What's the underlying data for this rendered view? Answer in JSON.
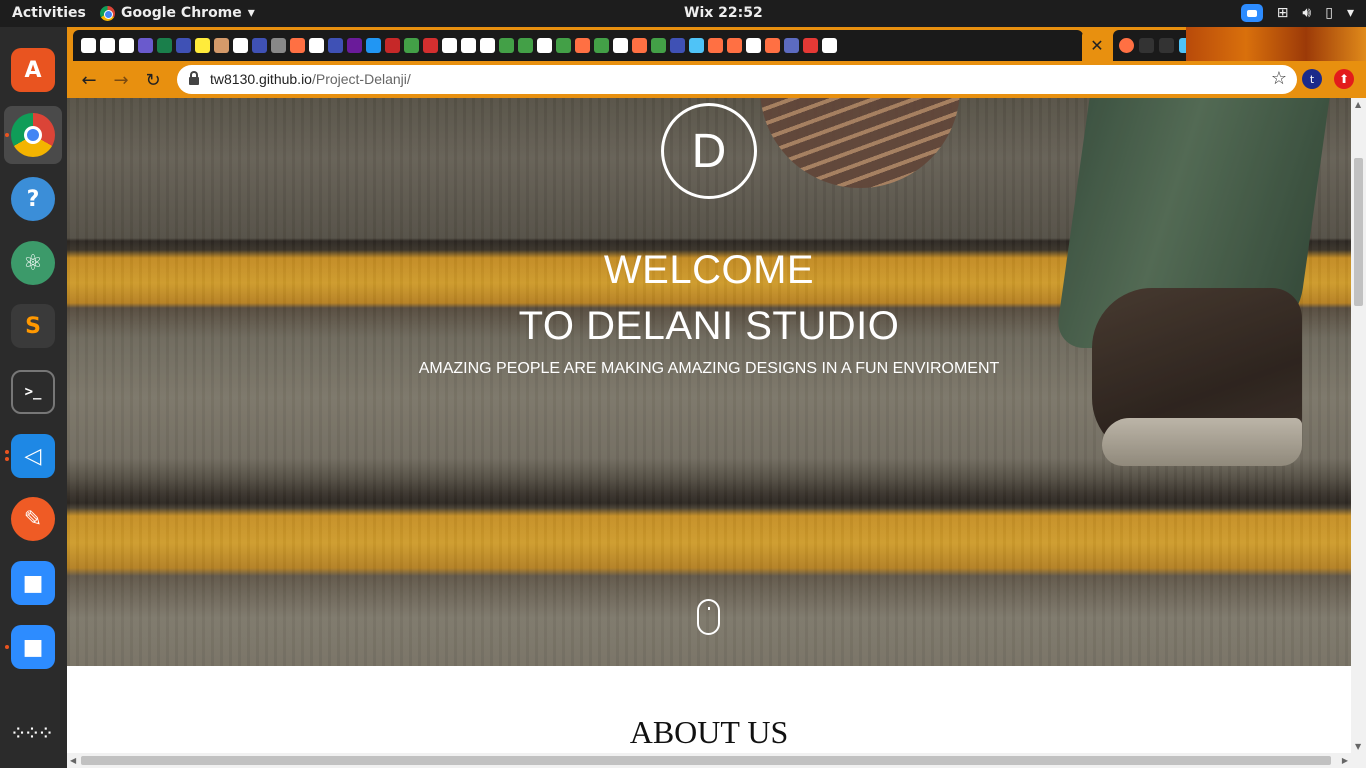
{
  "topbar": {
    "activities": "Activities",
    "app_name": "Google Chrome",
    "app_menu_arrow": "▾",
    "clock": "Wix 22:52"
  },
  "browser": {
    "active_tab_close": "✕",
    "new_tab": "+",
    "url_host": "tw8130.github.io",
    "url_path": "/Project-Delanji/",
    "profile_initial": "t",
    "back": "←",
    "forward": "→",
    "reload": "↻",
    "star": "☆",
    "extension_glyph": "⬆"
  },
  "page": {
    "logo_letter": "D",
    "welcome_line1": "WELCOME",
    "welcome_line2": "TO DELANI STUDIO",
    "tagline": "AMAZING PEOPLE ARE MAKING AMAZING DESIGNS IN A FUN ENVIROMENT",
    "about_heading": "ABOUT US"
  },
  "dock": {
    "items": [
      {
        "name": "software-center-icon",
        "glyph": "A",
        "color": "#e95420"
      },
      {
        "name": "chrome-icon",
        "glyph": "",
        "color": "#4285f4"
      },
      {
        "name": "help-icon",
        "glyph": "?",
        "color": "#3b8ed8"
      },
      {
        "name": "atom-icon",
        "glyph": "⚛",
        "color": "#3c9a6a"
      },
      {
        "name": "sublime-text-icon",
        "glyph": "S",
        "color": "#3a3a3a"
      },
      {
        "name": "terminal-icon",
        "glyph": ">_",
        "color": "#2c2c2c"
      },
      {
        "name": "vscode-icon",
        "glyph": "◁",
        "color": "#1e88e5"
      },
      {
        "name": "postman-icon",
        "glyph": "✎",
        "color": "#ef5b25"
      },
      {
        "name": "zoom-icon",
        "glyph": "■",
        "color": "#2d8cff"
      },
      {
        "name": "zoom-icon-2",
        "glyph": "■",
        "color": "#2d8cff"
      },
      {
        "name": "show-apps-icon",
        "glyph": "⋮⋮⋮",
        "color": "#2b2b2b"
      }
    ]
  },
  "tab_favicon_colors": [
    "#fff",
    "#fff",
    "#fff",
    "#6a5acd",
    "#1a7f4b",
    "#3f51b5",
    "#ffeb3b",
    "#d49a6a",
    "#fff",
    "#3f51b5",
    "#888",
    "#ff7043",
    "#fff",
    "#3f51b5",
    "#6a1b9a",
    "#2196f3",
    "#c62828",
    "#43a047",
    "#d32f2f",
    "#fff",
    "#fff",
    "#fff",
    "#43a047",
    "#43a047",
    "#fff",
    "#43a047",
    "#ff7043",
    "#43a047",
    "#fff",
    "#ff7043",
    "#43a047",
    "#3f51b5",
    "#4fc3f7",
    "#ff7043",
    "#ff7043",
    "#fff",
    "#ff7043",
    "#5c6bc0",
    "#e53935",
    "#fff"
  ]
}
